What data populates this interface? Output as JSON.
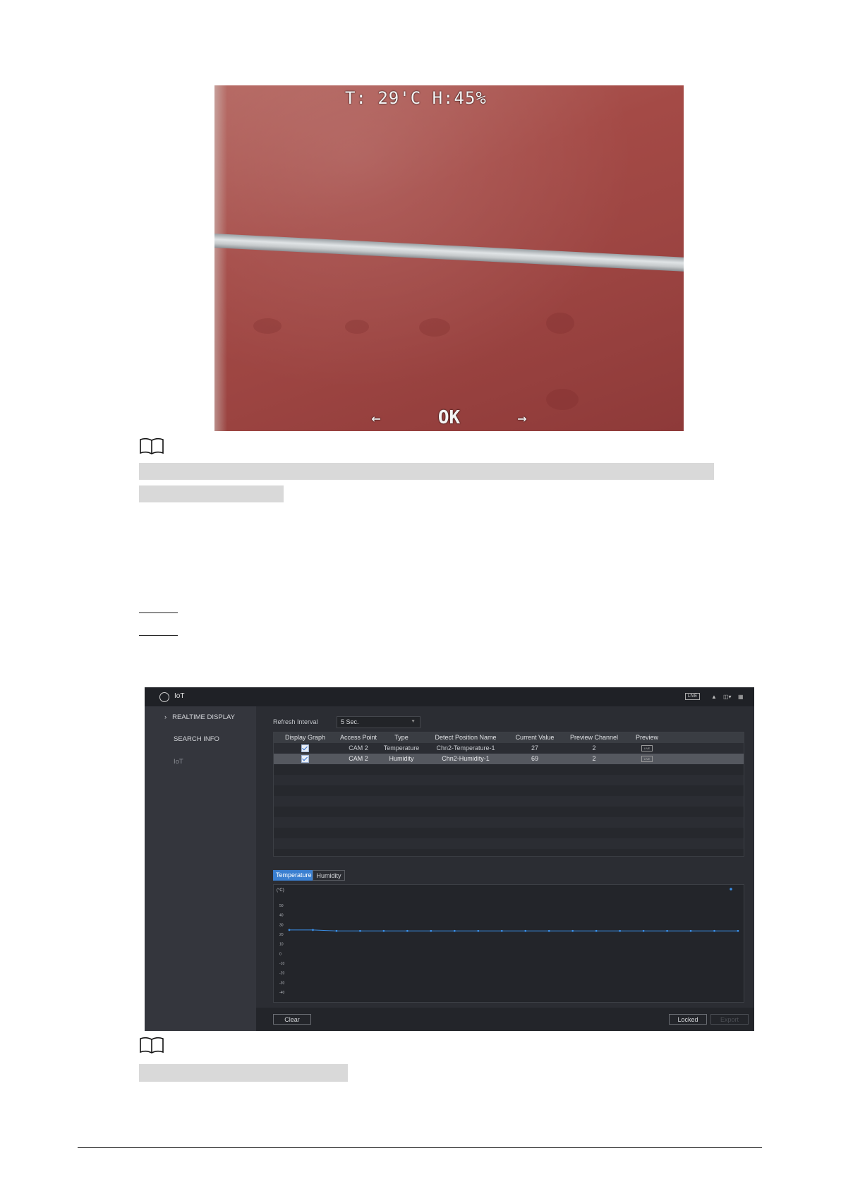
{
  "camera_osd": {
    "top_text": "T: 29'C H:45%",
    "left_arrow": "←",
    "ok": "OK",
    "right_arrow": "→"
  },
  "note_icons": [
    "book-icon",
    "book-icon"
  ],
  "iot": {
    "title": "IoT",
    "live_badge": "LIVE",
    "sidebar": {
      "arrow": "›",
      "items": [
        "REALTIME DISPLAY",
        "SEARCH INFO",
        "IoT"
      ]
    },
    "refresh": {
      "label": "Refresh Interval",
      "value": "5 Sec."
    },
    "table": {
      "headers": [
        "Display Graph",
        "Access Point",
        "Type",
        "Detect Position Name",
        "Current Value",
        "Preview Channel",
        "Preview"
      ],
      "rows": [
        {
          "display": true,
          "access_point": "CAM 2",
          "type": "Temperature",
          "position": "Chn2-Temperature-1",
          "value": "27",
          "channel": "2",
          "preview": "LIVE"
        },
        {
          "display": true,
          "access_point": "CAM 2",
          "type": "Humidity",
          "position": "Chn2-Humidity-1",
          "value": "69",
          "channel": "2",
          "preview": "LIVE"
        }
      ]
    },
    "tabs": [
      "Temperature",
      "Humidity"
    ],
    "buttons": {
      "clear": "Clear",
      "locked": "Locked",
      "export": "Export"
    }
  },
  "chart_data": {
    "type": "line",
    "ylabel": "(°C)",
    "yticks": [
      50,
      40,
      30,
      20,
      10,
      0,
      -10,
      -20,
      -30,
      -40
    ],
    "ylim": [
      -40,
      50
    ],
    "series": [
      {
        "values": [
          24.5,
          24.5,
          23.5,
          23.5,
          23.5,
          23.5,
          23.5,
          23.5,
          23.5,
          23.5,
          23.5,
          23.5,
          23.5,
          23.5,
          23.5,
          23.5,
          23.5,
          23.5,
          23.5,
          23.5
        ],
        "color": "#3a8fe8"
      }
    ],
    "grid": false
  }
}
